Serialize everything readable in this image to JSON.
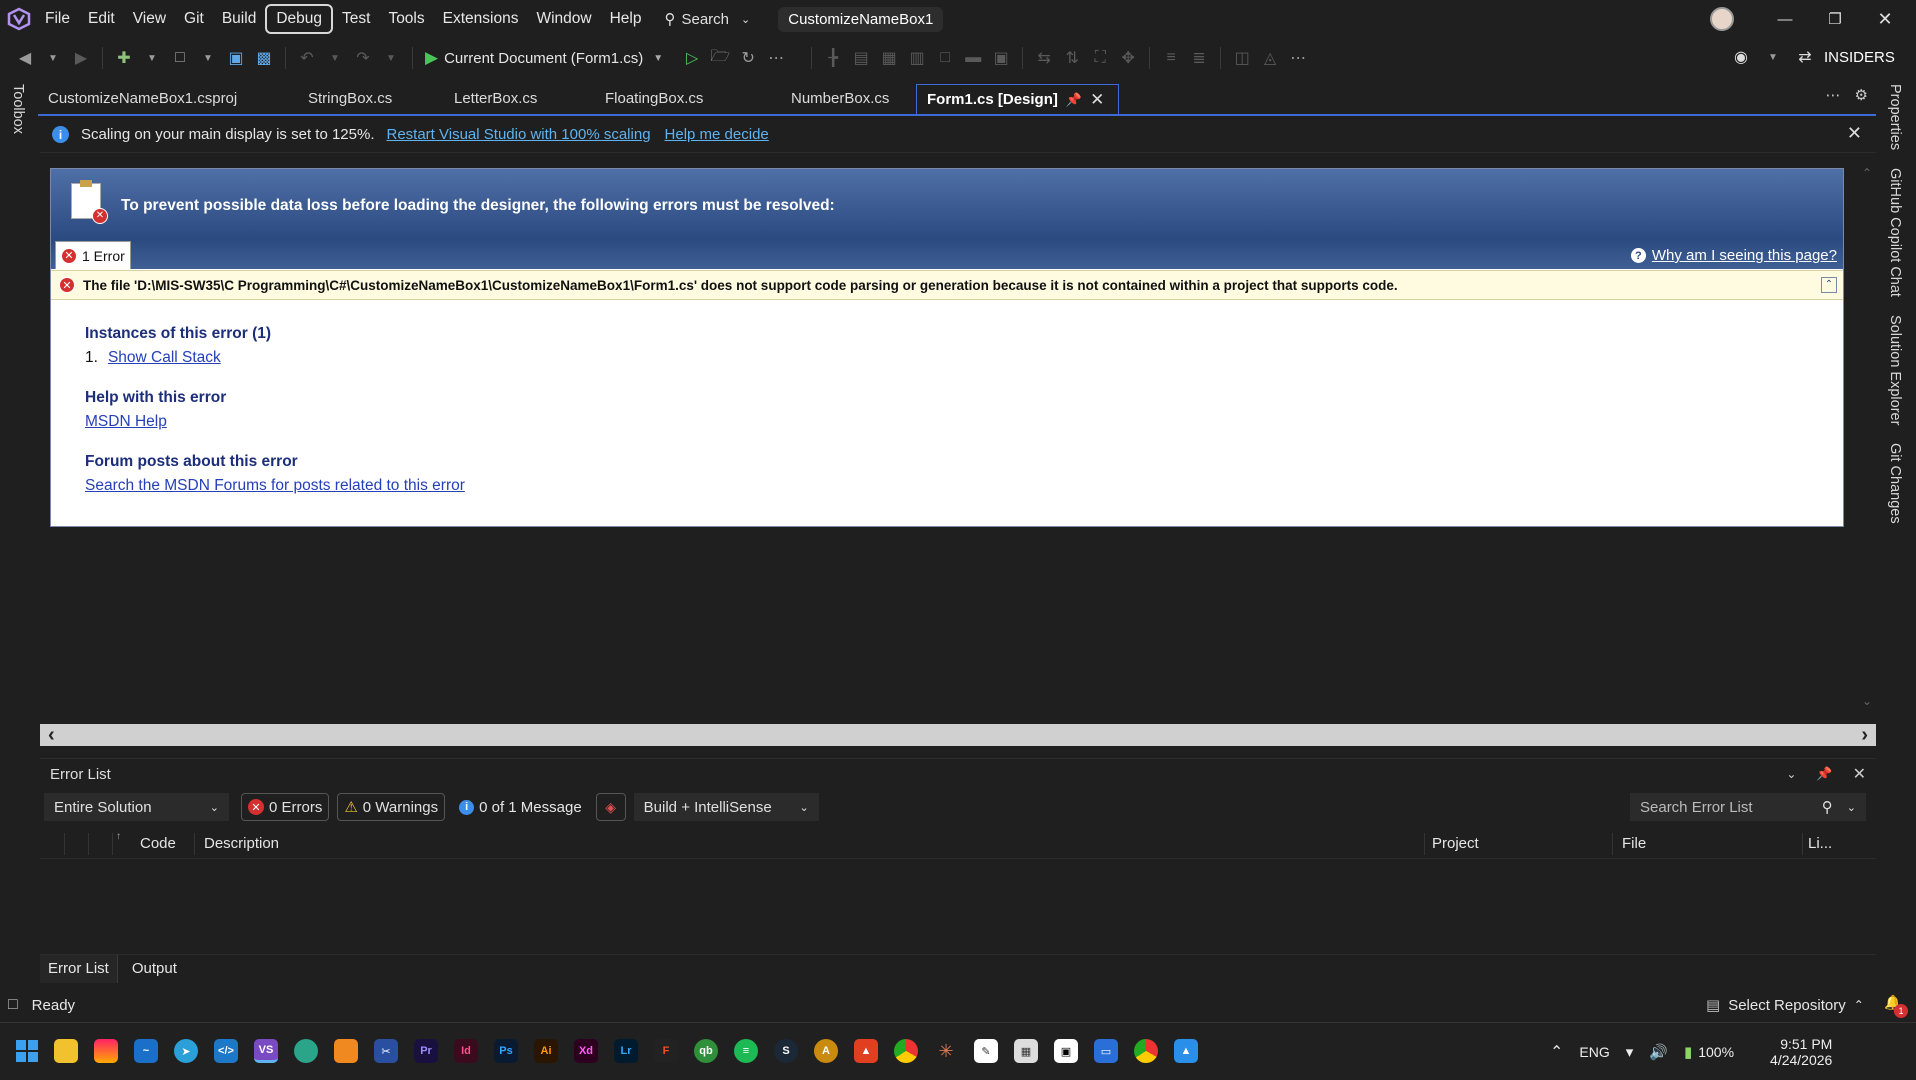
{
  "menubar": {
    "items": [
      "File",
      "Edit",
      "View",
      "Git",
      "Build",
      "Debug",
      "Test",
      "Tools",
      "Extensions",
      "Window",
      "Help"
    ],
    "search_label": "Search",
    "solution_name": "CustomizeNameBox1"
  },
  "toolbar": {
    "run_target": "Current Document (Form1.cs)",
    "insiders_label": "INSIDERS"
  },
  "tabs": [
    {
      "label": "CustomizeNameBox1.csproj"
    },
    {
      "label": "StringBox.cs"
    },
    {
      "label": "LetterBox.cs"
    },
    {
      "label": "FloatingBox.cs"
    },
    {
      "label": "NumberBox.cs"
    },
    {
      "label": "Form1.cs [Design]"
    }
  ],
  "left_rail": {
    "toolbox": "Toolbox"
  },
  "right_rail": [
    "Properties",
    "GitHub Copilot Chat",
    "Solution Explorer",
    "Git Changes"
  ],
  "infobar": {
    "message": "Scaling on your main display is set to 125%.",
    "restart_link": "Restart Visual Studio with 100% scaling",
    "help_link": "Help me decide"
  },
  "designer_error": {
    "heading": "To prevent possible data loss before loading the designer, the following errors must be resolved:",
    "error_count_label": "1 Error",
    "why_link": "Why am I seeing this page?",
    "message": "The file 'D:\\MIS-SW35\\C Programming\\C#\\CustomizeNameBox1\\CustomizeNameBox1\\Form1.cs' does not support code parsing or generation because it is not contained within a project that supports code.",
    "instances_title": "Instances of this error (1)",
    "instance_number": "1.",
    "call_stack_link": "Show Call Stack",
    "help_title": "Help with this error",
    "msdn_link": "MSDN Help",
    "forum_title": "Forum posts about this error",
    "forum_link": "Search the MSDN Forums for posts related to this error"
  },
  "error_list": {
    "title": "Error List",
    "scope": "Entire Solution",
    "errors": "0 Errors",
    "warnings": "0 Warnings",
    "messages": "0 of 1 Message",
    "build_filter": "Build + IntelliSense",
    "search_placeholder": "Search Error List",
    "columns": [
      "Code",
      "Description",
      "Project",
      "File",
      "Li..."
    ]
  },
  "bottom_tabs": [
    "Error List",
    "Output"
  ],
  "status": {
    "ready": "Ready",
    "repo": "Select Repository"
  },
  "taskbar": {
    "lang": "ENG",
    "battery": "100%",
    "time": "9:51 PM",
    "date": "4/24/2026",
    "notif_count": "1"
  }
}
